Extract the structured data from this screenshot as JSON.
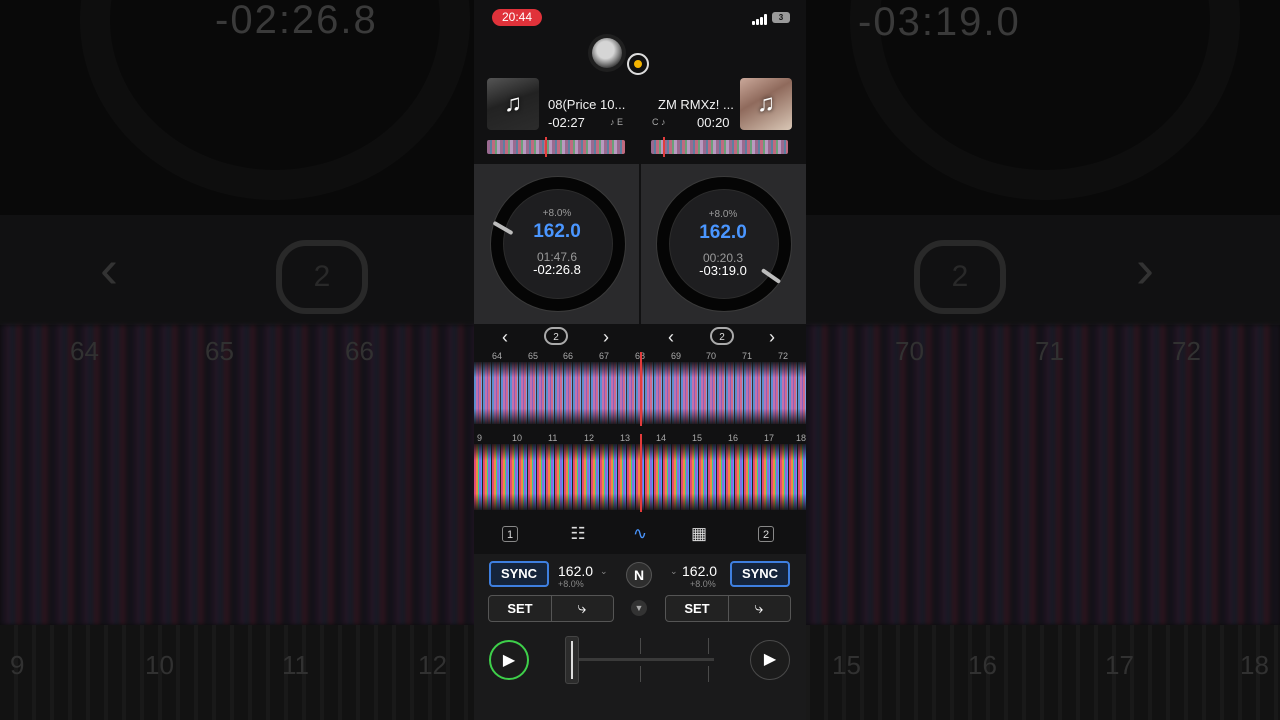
{
  "status": {
    "time": "20:44",
    "battery": "3"
  },
  "background": {
    "left_time": "-02:26.8",
    "right_time": "-03:19.0",
    "loop_count": "2",
    "beats_top": [
      "64",
      "65",
      "66",
      "70",
      "71",
      "72"
    ],
    "beats_bottom": [
      "9",
      "10",
      "11",
      "12",
      "15",
      "16",
      "17",
      "18"
    ]
  },
  "deck_a": {
    "title": "08(Price 10...",
    "remaining": "-02:27",
    "flags": "♪  E",
    "pitch": "+8.0%",
    "bpm": "162.0",
    "elapsed": "01:47.6",
    "remain_long": "-02:26.8",
    "loop": "2",
    "number": "1",
    "sync": "SYNC",
    "tempo": "162.0",
    "tempo_pitch": "+8.0%",
    "set": "SET",
    "art_icon": "music-note-icon"
  },
  "deck_b": {
    "title": "ZM RMXz! ...",
    "elapsed_short": "00:20",
    "flags": "C ♪",
    "pitch": "+8.0%",
    "bpm": "162.0",
    "elapsed": "00:20.3",
    "remain_long": "-03:19.0",
    "loop": "2",
    "number": "2",
    "sync": "SYNC",
    "tempo": "162.0",
    "tempo_pitch": "+8.0%",
    "set": "SET",
    "art_icon": "music-note-icon"
  },
  "waveform_top_beats": [
    "64",
    "65",
    "66",
    "67",
    "68",
    "69",
    "70",
    "71",
    "72"
  ],
  "waveform_bottom_beats": [
    "9",
    "10",
    "11",
    "12",
    "13",
    "14",
    "15",
    "16",
    "17",
    "18"
  ],
  "center": {
    "n_label": "N"
  },
  "colors": {
    "accent_blue": "#4a96ff",
    "sync_border": "#3e7fe0",
    "record": "#f4b400",
    "playhead": "#e23c3c",
    "play_active": "#3ed04a",
    "time_pill": "#e0323a"
  }
}
